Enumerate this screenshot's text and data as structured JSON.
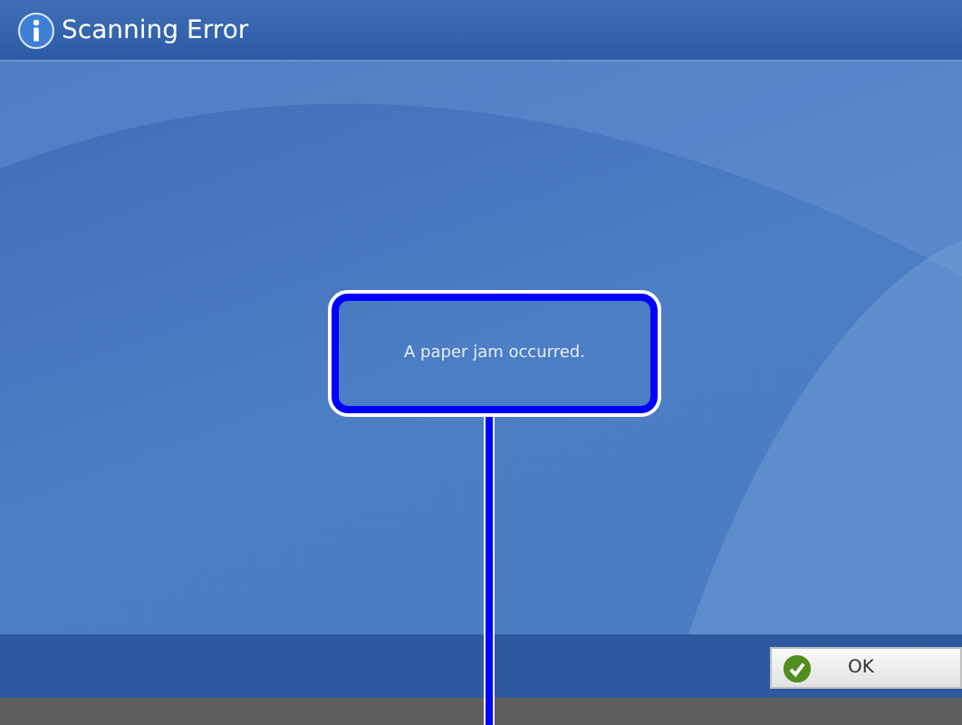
{
  "window": {
    "title": "Scanning Error"
  },
  "message": "A paper jam occurred.",
  "buttons": [
    {
      "label": "OK",
      "kind": "confirm"
    }
  ]
}
